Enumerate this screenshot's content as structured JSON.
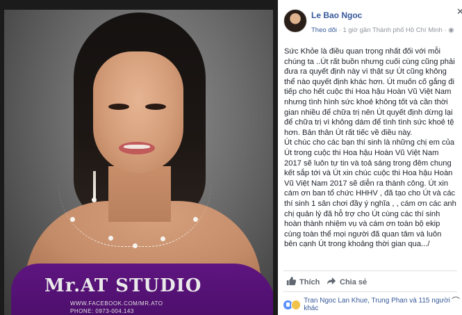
{
  "photo": {
    "logo": "Mr.AT STUDIO",
    "logo_sub1": "WWW.FACEBOOK.COM/MR.ATO",
    "logo_sub2": "PHONE: 0973-004.143"
  },
  "post_header": {
    "author": "Le Bao Ngoc",
    "follow_label": "Theo dõi",
    "separator": " · ",
    "time_location": "1 giờ gần Thành phố Hồ Chí Minh",
    "privacy_glyph": "· ◉"
  },
  "post_body": {
    "p1": "Sức Khỏe là điều quan trọng nhất đối với mỗi chúng ta ..Út rất buồn nhưng cuối cùng cũng phải đưa ra quyết định này vì thật sự Út cũng không thể nào quyết định khác hơn. Út muốn cố gắng đi tiếp cho hết cuộc thi Hoa hậu Hoàn Vũ Việt Nam nhưng tình hình sức khoẻ không tốt và cần thời gian nhiều để chữa trị nên Út quyết định dừng lại để chữa trị vì không dám để tình tình sức khoẻ tệ hơn. Bản thân Út rất tiếc về điều này.",
    "p2": "Út chúc cho các bạn thí sinh là những chị em của Út trong cuộc thi Hoa hậu Hoàn Vũ Việt Nam 2017 sẽ luôn tự tin và toả sáng trong đêm chung kết sắp tới và Út xin chúc cuộc thi Hoa hậu Hoàn Vũ Việt Nam 2017 sẽ diễn ra thành công. Út xin cám ơn ban tổ chức HHHV , đã tạo cho Út và các thí sinh 1 sân chơi đầy ý nghĩa , , cám ơn các anh chị quản lý đã hỗ trợ cho Út cùng các thí sinh hoàn thành nhiệm vụ và cám ơn toàn bộ ekip cùng toàn thể mọi người đã quan tâm và luôn bên cạnh Út trong khoảng thời gian qua.../"
  },
  "actions": {
    "like_label": "Thích",
    "share_label": "Chia sẻ"
  },
  "reactions": {
    "text": "Tran Ngoc Lan Khue, Trung Phan và 115 người khác"
  },
  "colors": {
    "link": "#365899",
    "dress": "#5e1580"
  }
}
